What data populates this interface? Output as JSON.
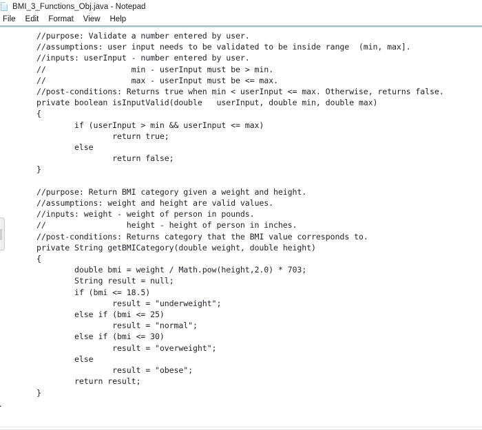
{
  "window": {
    "title": "BMI_3_Functions_Obj.java - Notepad",
    "icon": "notepad-document-icon"
  },
  "menubar": {
    "items": [
      {
        "label": "File"
      },
      {
        "label": "Edit"
      },
      {
        "label": "Format"
      },
      {
        "label": "View"
      },
      {
        "label": "Help"
      }
    ]
  },
  "editor": {
    "language": "java",
    "orphan_closing_brace": "}",
    "content": "//purpose: Validate a number entered by user.\n//assumptions: user input needs to be validated to be inside range  (min, max].\n//inputs: userInput - number entered by user.\n//                  min - userInput must be > min.\n//                  max - userInput must be <= max.\n//post-conditions: Returns true when min < userInput <= max. Otherwise, returns false.\nprivate boolean isInputValid(double   userInput, double min, double max)\n{\n        if (userInput > min && userInput <= max)\n                return true;\n        else\n                return false;\n}\n\n//purpose: Return BMI category given a weight and height.\n//assumptions: weight and height are valid values.\n//inputs: weight - weight of person in pounds.\n//                 height - height of person in inches.\n//post-conditions: Returns category that the BMI value corresponds to.\nprivate String getBMICategory(double weight, double height)\n{\n        double bmi = weight / Math.pow(height,2.0) * 703;\n        String result = null;\n        if (bmi <= 18.5)\n                result = \"underweight\";\n        else if (bmi <= 25)\n                result = \"normal\";\n        else if (bmi <= 30)\n                result = \"overweight\";\n        else\n                result = \"obese\";\n        return result;\n}"
  },
  "scrollbar": {
    "orientation": "vertical",
    "name": "vertical-scrollbar-thumb"
  },
  "colors": {
    "text": "#20242c",
    "menu_rule": "#7fa8b4",
    "background": "#ffffff"
  }
}
